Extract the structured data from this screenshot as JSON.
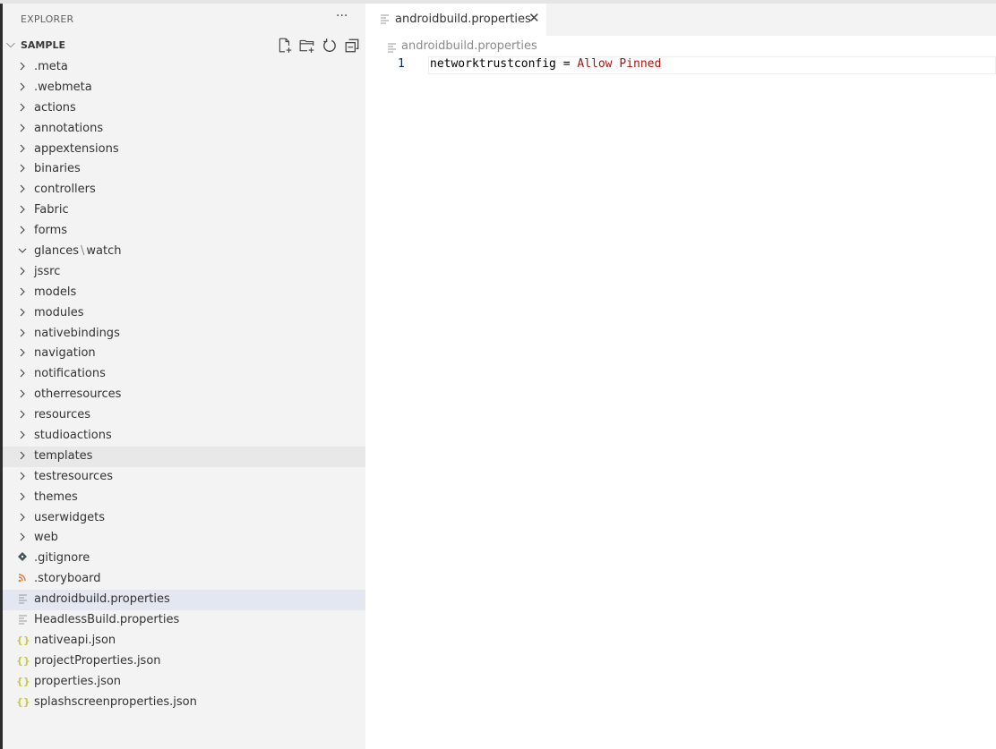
{
  "explorer": {
    "title": "EXPLORER",
    "more_label": "···",
    "section": "SAMPLE"
  },
  "tree": [
    {
      "type": "folder",
      "name": ".meta"
    },
    {
      "type": "folder",
      "name": ".webmeta"
    },
    {
      "type": "folder",
      "name": "actions"
    },
    {
      "type": "folder",
      "name": "annotations"
    },
    {
      "type": "folder",
      "name": "appextensions"
    },
    {
      "type": "folder",
      "name": "binaries"
    },
    {
      "type": "folder",
      "name": "controllers"
    },
    {
      "type": "folder",
      "name": "Fabric"
    },
    {
      "type": "folder",
      "name": "forms"
    },
    {
      "type": "folder-open",
      "name": "glances",
      "name2": "watch",
      "sep": "\\"
    },
    {
      "type": "folder",
      "name": "jssrc"
    },
    {
      "type": "folder",
      "name": "models"
    },
    {
      "type": "folder",
      "name": "modules"
    },
    {
      "type": "folder",
      "name": "nativebindings"
    },
    {
      "type": "folder",
      "name": "navigation"
    },
    {
      "type": "folder",
      "name": "notifications"
    },
    {
      "type": "folder",
      "name": "otherresources"
    },
    {
      "type": "folder",
      "name": "resources"
    },
    {
      "type": "folder",
      "name": "studioactions"
    },
    {
      "type": "folder",
      "name": "templates",
      "state": "hover"
    },
    {
      "type": "folder",
      "name": "testresources"
    },
    {
      "type": "folder",
      "name": "themes"
    },
    {
      "type": "folder",
      "name": "userwidgets"
    },
    {
      "type": "folder",
      "name": "web"
    },
    {
      "type": "git",
      "name": ".gitignore"
    },
    {
      "type": "rss",
      "name": ".storyboard"
    },
    {
      "type": "text",
      "name": "androidbuild.properties",
      "state": "selected"
    },
    {
      "type": "text",
      "name": "HeadlessBuild.properties"
    },
    {
      "type": "json",
      "name": "nativeapi.json"
    },
    {
      "type": "json",
      "name": "projectProperties.json"
    },
    {
      "type": "json",
      "name": "properties.json"
    },
    {
      "type": "json",
      "name": "splashscreenproperties.json"
    }
  ],
  "editor": {
    "tab_label": "androidbuild.properties",
    "close_label": "✕",
    "breadcrumb": "androidbuild.properties",
    "line_number": "1",
    "code_key": "networktrustconfig",
    "code_op": " = ",
    "code_value": "Allow Pinned"
  },
  "colors": {
    "json_icon": "#cbcb41",
    "rss_icon": "#e37933",
    "git_icon": "#41535b",
    "text_icon": "#9a9a9a"
  }
}
